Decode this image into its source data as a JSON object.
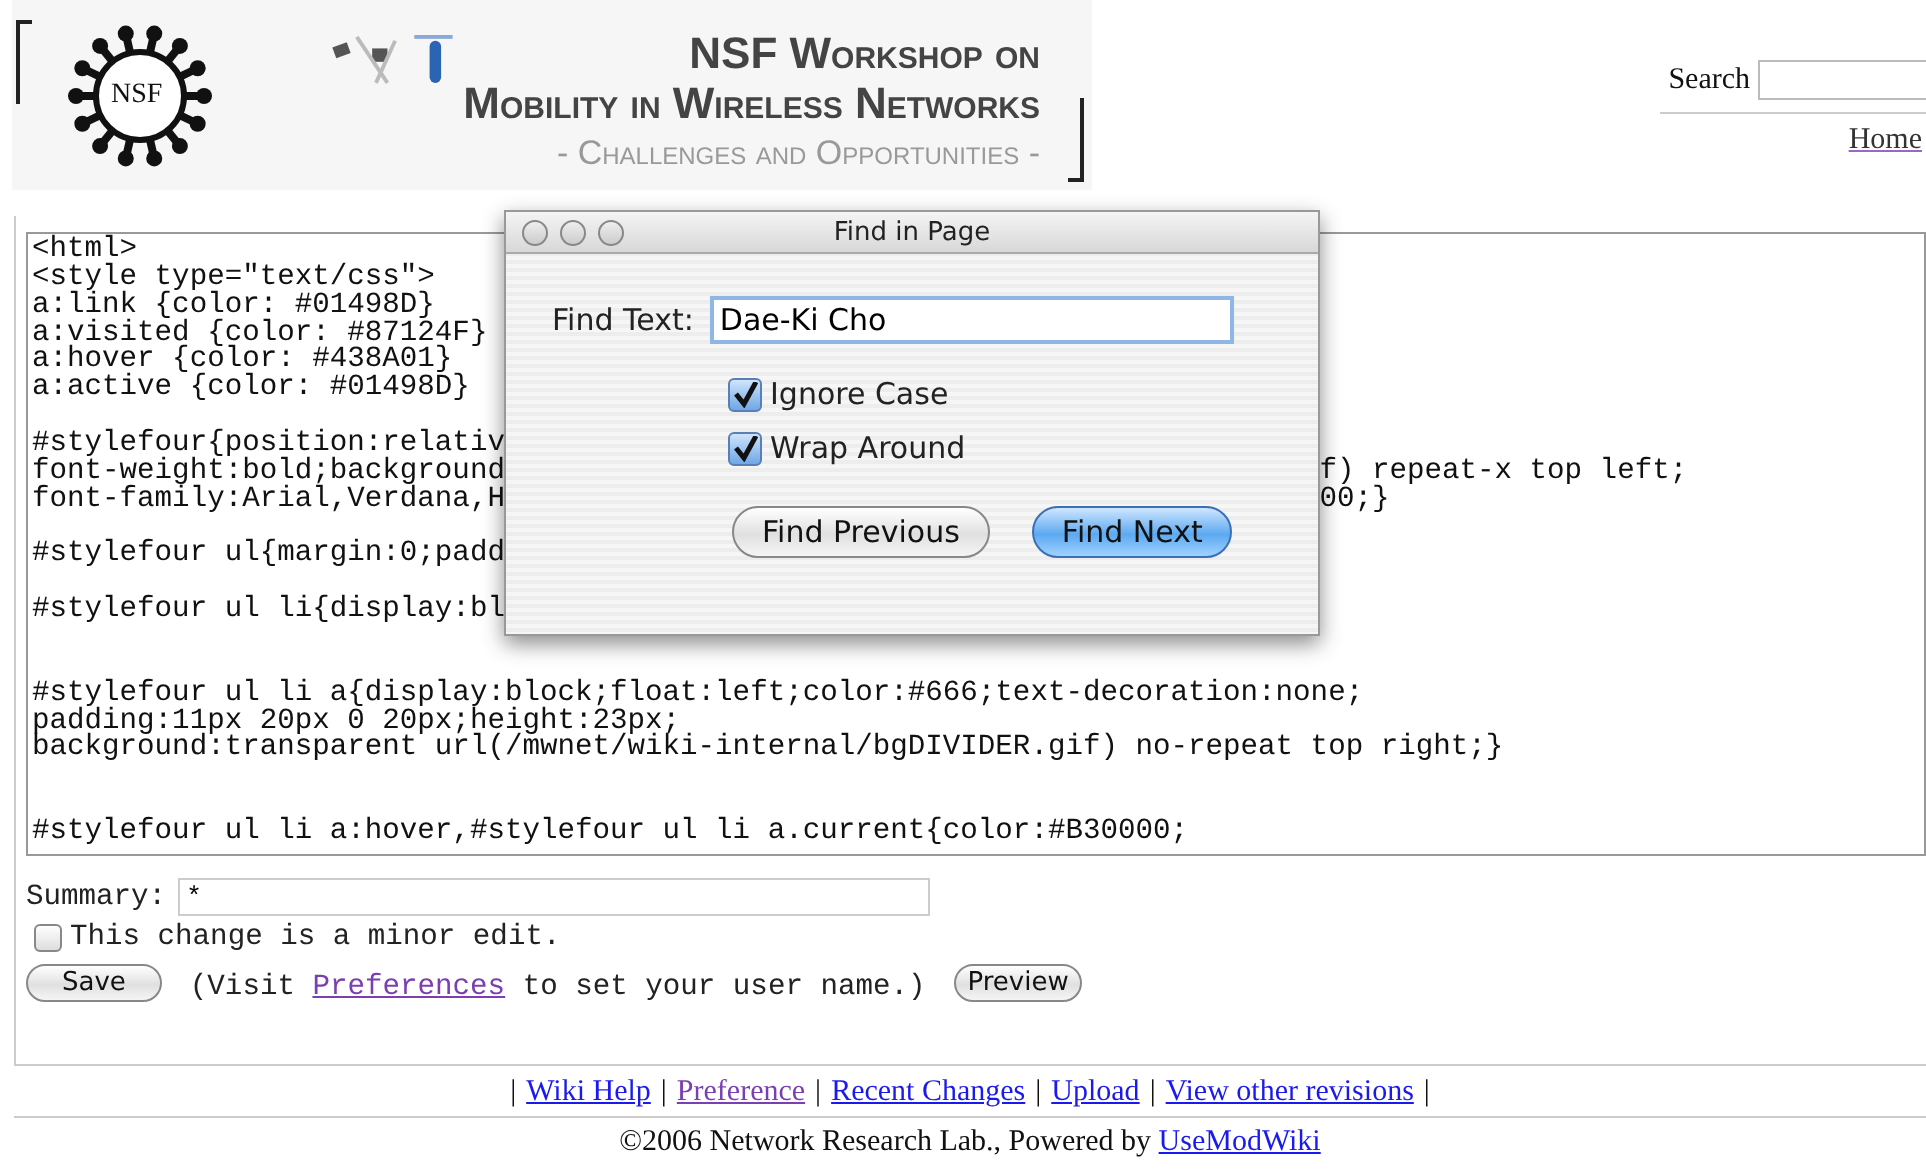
{
  "header": {
    "logo_text": "NSF",
    "title_lines": [
      "NSF Workshop on",
      "Mobility in Wireless Networks",
      "- Challenges and Opportunities -"
    ]
  },
  "search": {
    "label": "Search"
  },
  "home_link": "Home",
  "editor": {
    "lines": [
      {
        "kind": "text",
        "left": "<html>"
      },
      {
        "kind": "text",
        "left": "<style type=\"text/css\">"
      },
      {
        "kind": "text",
        "left": "a:link {color: #01498D}"
      },
      {
        "kind": "text",
        "left": "a:visited {color: #87124F}"
      },
      {
        "kind": "text",
        "left": "a:hover {color: #438A01}"
      },
      {
        "kind": "text",
        "left": "a:active {color: #01498D}"
      },
      {
        "kind": "blank"
      },
      {
        "kind": "text",
        "left": "#stylefour{position:relativ"
      },
      {
        "kind": "text",
        "left": "font-weight:bold;background",
        "right": "f) repeat-x top left;"
      },
      {
        "kind": "text",
        "left": "font-family:Arial,Verdana,H",
        "right": "00;}"
      },
      {
        "kind": "blank"
      },
      {
        "kind": "text",
        "left": "#stylefour ul{margin:0;padd"
      },
      {
        "kind": "blank"
      },
      {
        "kind": "text",
        "left": "#stylefour ul li{display:bl"
      },
      {
        "kind": "blank"
      },
      {
        "kind": "blank"
      },
      {
        "kind": "text",
        "left": "#stylefour ul li a{display:block;float:left;color:#666;text-decoration:none;"
      },
      {
        "kind": "text",
        "left": "padding:11px 20px 0 20px;height:23px;"
      },
      {
        "kind": "text",
        "left": "background:transparent url(/mwnet/wiki-internal/bgDIVIDER.gif) no-repeat top right;}"
      },
      {
        "kind": "blank"
      },
      {
        "kind": "blank"
      },
      {
        "kind": "text",
        "left": "#stylefour ul li a:hover,#stylefour ul li a.current{color:#B30000;"
      }
    ]
  },
  "summary": {
    "label": "Summary:",
    "value": "*"
  },
  "minor_edit": {
    "label": "This change is a minor edit.",
    "checked": false
  },
  "save_button": "Save",
  "preview_button": "Preview",
  "visit_note": {
    "before": "(Visit ",
    "link": "Preferences",
    "link_visited": true,
    "after": " to set your user name.)"
  },
  "footer": {
    "separator": "|",
    "links": [
      {
        "label": "Wiki Help",
        "visited": false
      },
      {
        "label": "Preference",
        "visited": true
      },
      {
        "label": "Recent Changes",
        "visited": false
      },
      {
        "label": "Upload",
        "visited": false
      },
      {
        "label": "View other revisions",
        "visited": false
      }
    ],
    "copyright": "©2006 Network Research Lab., Powered by ",
    "powered_link": "UseModWiki"
  },
  "dialog": {
    "title": "Find in Page",
    "find_label": "Find Text:",
    "find_value": "Dae-Ki Cho",
    "options": [
      {
        "label": "Ignore Case",
        "checked": true
      },
      {
        "label": "Wrap Around",
        "checked": true
      }
    ],
    "buttons": [
      {
        "label": "Find Previous",
        "default": false
      },
      {
        "label": "Find Next",
        "default": true
      }
    ]
  }
}
